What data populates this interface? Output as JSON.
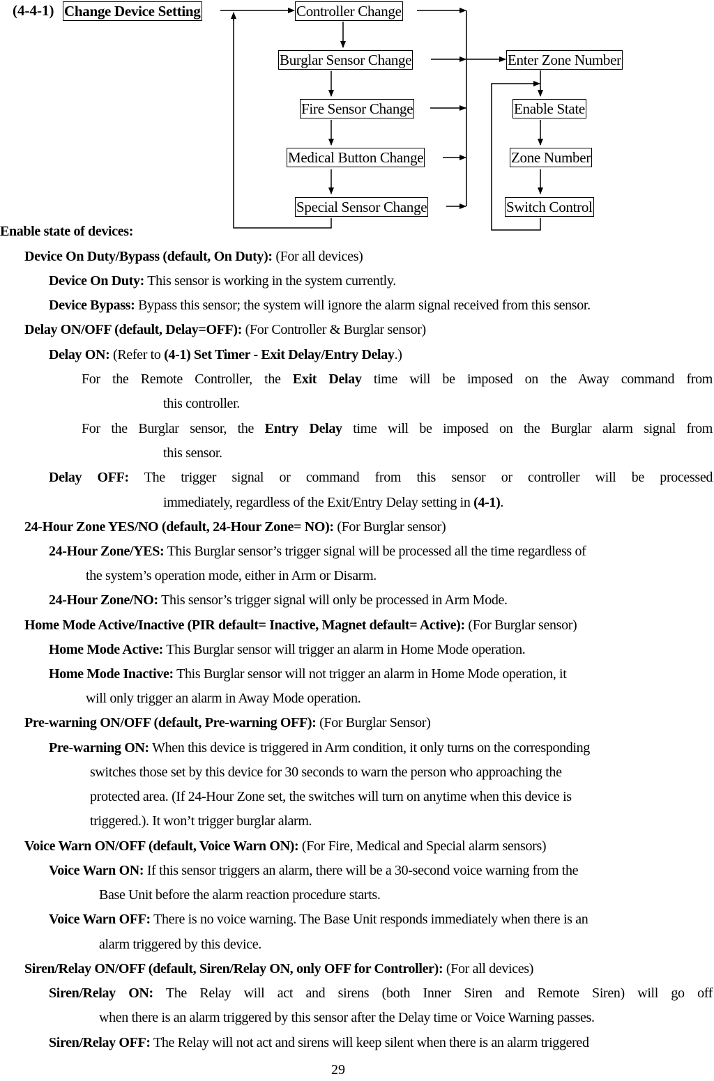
{
  "diagram": {
    "section_label": "(4-4-1)",
    "title": "Change Device Setting",
    "left_column": [
      "Controller Change",
      "Burglar Sensor Change",
      "Fire Sensor Change",
      "Medical Button Change",
      "Special Sensor Change"
    ],
    "right_column": [
      "Enter Zone Number",
      "Enable State",
      "Zone Number",
      "Switch Control"
    ]
  },
  "content": {
    "enable_heading": "Enable state of devices:",
    "duty": {
      "title": "Device On Duty/Bypass (default, On Duty):",
      "scope": " (For all devices)",
      "on_label": "Device On Duty:",
      "on_text": " This sensor is working in the system currently.",
      "bypass_label": "Device Bypass:",
      "bypass_text": " Bypass this sensor; the system will ignore the alarm signal received from this sensor."
    },
    "delay": {
      "title": "Delay ON/OFF (default, Delay=OFF):",
      "scope": " (For Controller & Burglar sensor)",
      "on_label": "Delay ON:",
      "on_refer_prefix": " (Refer to ",
      "on_refer_bold": "(4-1) Set Timer - Exit Delay/Entry Delay",
      "on_refer_suffix": ".)",
      "remote_prefix": "For the Remote Controller, the ",
      "remote_bold": "Exit Delay",
      "remote_suffix": " time will be imposed on the Away command from",
      "remote_cont": "this controller.",
      "burglar_prefix": "For the Burglar sensor, the ",
      "burglar_bold": "Entry Delay",
      "burglar_suffix": " time will be imposed on the Burglar alarm signal from",
      "burglar_cont": "this sensor.",
      "off_label": "Delay  OFF:",
      "off_text": " The trigger signal or command from this sensor or controller will be processed",
      "off_cont_prefix": "immediately, regardless of the Exit/Entry Delay setting in ",
      "off_cont_bold": "(4-1)",
      "off_cont_suffix": "."
    },
    "zone24": {
      "title": "24-Hour Zone YES/NO (default, 24-Hour Zone= NO):",
      "scope": " (For Burglar sensor)",
      "yes_label": "24-Hour Zone/YES:",
      "yes_text": " This Burglar sensor’s trigger signal will be processed all the time regardless of",
      "yes_cont": "the system’s operation mode, either in Arm or Disarm.",
      "no_label": "24-Hour Zone/NO:",
      "no_text": " This sensor’s trigger signal will only be processed in Arm Mode."
    },
    "home_mode": {
      "title": "Home Mode Active/Inactive (PIR default= Inactive, Magnet default= Active):",
      "scope": " (For Burglar sensor)",
      "active_label": "Home Mode Active:",
      "active_text": " This Burglar sensor will trigger an alarm in Home Mode operation.",
      "inactive_label": "Home Mode Inactive:",
      "inactive_text": " This Burglar sensor will not trigger an alarm in Home Mode operation, it",
      "inactive_cont": "will only trigger an alarm in Away Mode operation."
    },
    "prewarning": {
      "title": "Pre-warning ON/OFF (default, Pre-warning OFF):",
      "scope": " (For Burglar Sensor)",
      "on_label": "Pre-warning ON:",
      "on_text": " When this device is triggered in Arm condition, it only turns on the corresponding",
      "on_cont1": "switches those set by this device for 30 seconds to warn the person who approaching the",
      "on_cont2": "protected area. (If 24-Hour Zone set, the switches will turn on anytime when this device is",
      "on_cont3": "triggered.). It won’t trigger burglar alarm."
    },
    "voice": {
      "title": "Voice Warn ON/OFF (default, Voice Warn ON):",
      "scope": " (For Fire, Medical and Special alarm sensors)",
      "on_label": "Voice Warn ON:",
      "on_text": " If this sensor triggers an alarm, there will be a 30-second voice warning from the",
      "on_cont": "Base Unit before the alarm reaction procedure starts.",
      "off_label": "Voice Warn OFF:",
      "off_text": " There is no voice warning. The Base Unit responds immediately when there is an",
      "off_cont": "alarm triggered by this device."
    },
    "siren": {
      "title": "Siren/Relay ON/OFF (default, Siren/Relay ON, only OFF for Controller):",
      "scope": " (For all devices)",
      "on_label": "Siren/Relay  ON:",
      "on_text": " The Relay will act and sirens (both Inner Siren and Remote Siren) will go off",
      "on_cont": "when there is an alarm triggered by this sensor after the Delay time or Voice Warning passes.",
      "off_label": "Siren/Relay OFF:",
      "off_text": " The Relay will not act and sirens will keep silent when there is an alarm triggered"
    }
  },
  "page_number": "29"
}
